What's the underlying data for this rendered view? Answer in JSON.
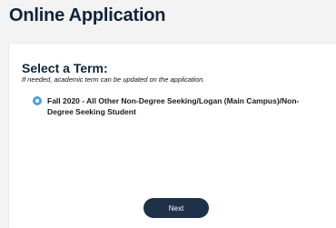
{
  "page": {
    "title": "Online Application"
  },
  "term_section": {
    "heading": "Select a Term:",
    "helper": "If needed, academic term can be updated on the application.",
    "options": [
      {
        "label": "Fall 2020 - All Other Non-Degree Seeking/Logan (Main Campus)/Non-Degree Seeking Student",
        "selected": true
      }
    ]
  },
  "actions": {
    "next_label": "Next"
  },
  "colors": {
    "title": "#0f2439",
    "radio": "#4aa1df",
    "button": "#1f3148"
  }
}
